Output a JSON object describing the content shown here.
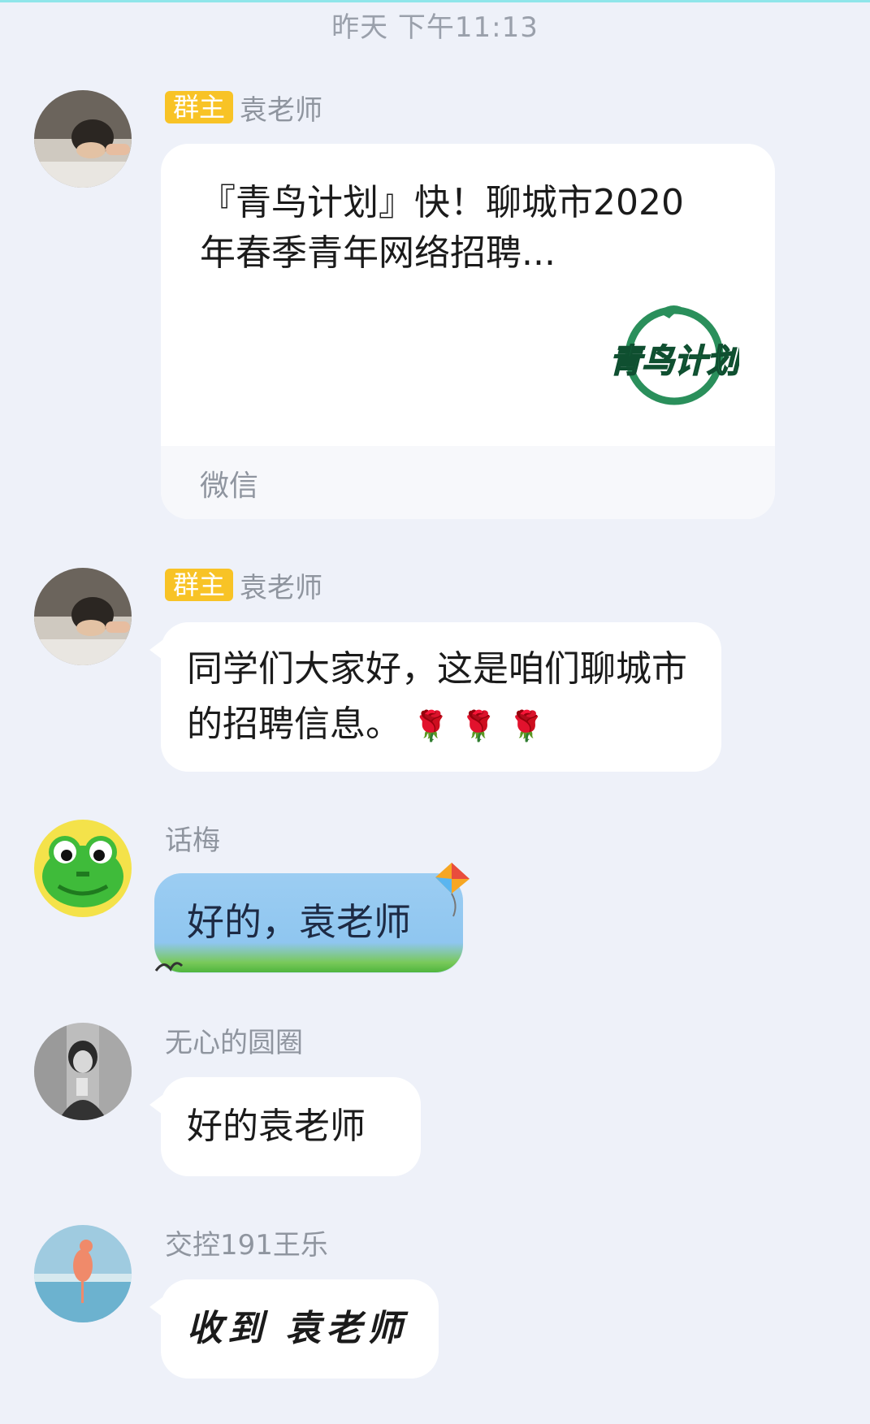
{
  "header": {
    "timestamp": "昨天 下午11:13"
  },
  "messages": [
    {
      "sender": "袁老师",
      "badge": "群主",
      "card": {
        "title": "『青鸟计划』快！聊城市2020年春季青年网络招聘...",
        "source": "微信",
        "logo_text": "青鸟计划"
      }
    },
    {
      "sender": "袁老师",
      "badge": "群主",
      "text": "同学们大家好，这是咱们聊城市的招聘信息。",
      "emoji": [
        "🌹",
        "🌹",
        "🌹"
      ]
    },
    {
      "sender": "话梅",
      "text": "好的，袁老师"
    },
    {
      "sender": "无心的圆圈",
      "text": "好的袁老师"
    },
    {
      "sender": "交控191王乐",
      "text": "收到 袁老师"
    }
  ],
  "colors": {
    "background": "#eef1f9",
    "badge": "#f8c326",
    "bubble": "#ffffff",
    "name": "#8f959f"
  }
}
